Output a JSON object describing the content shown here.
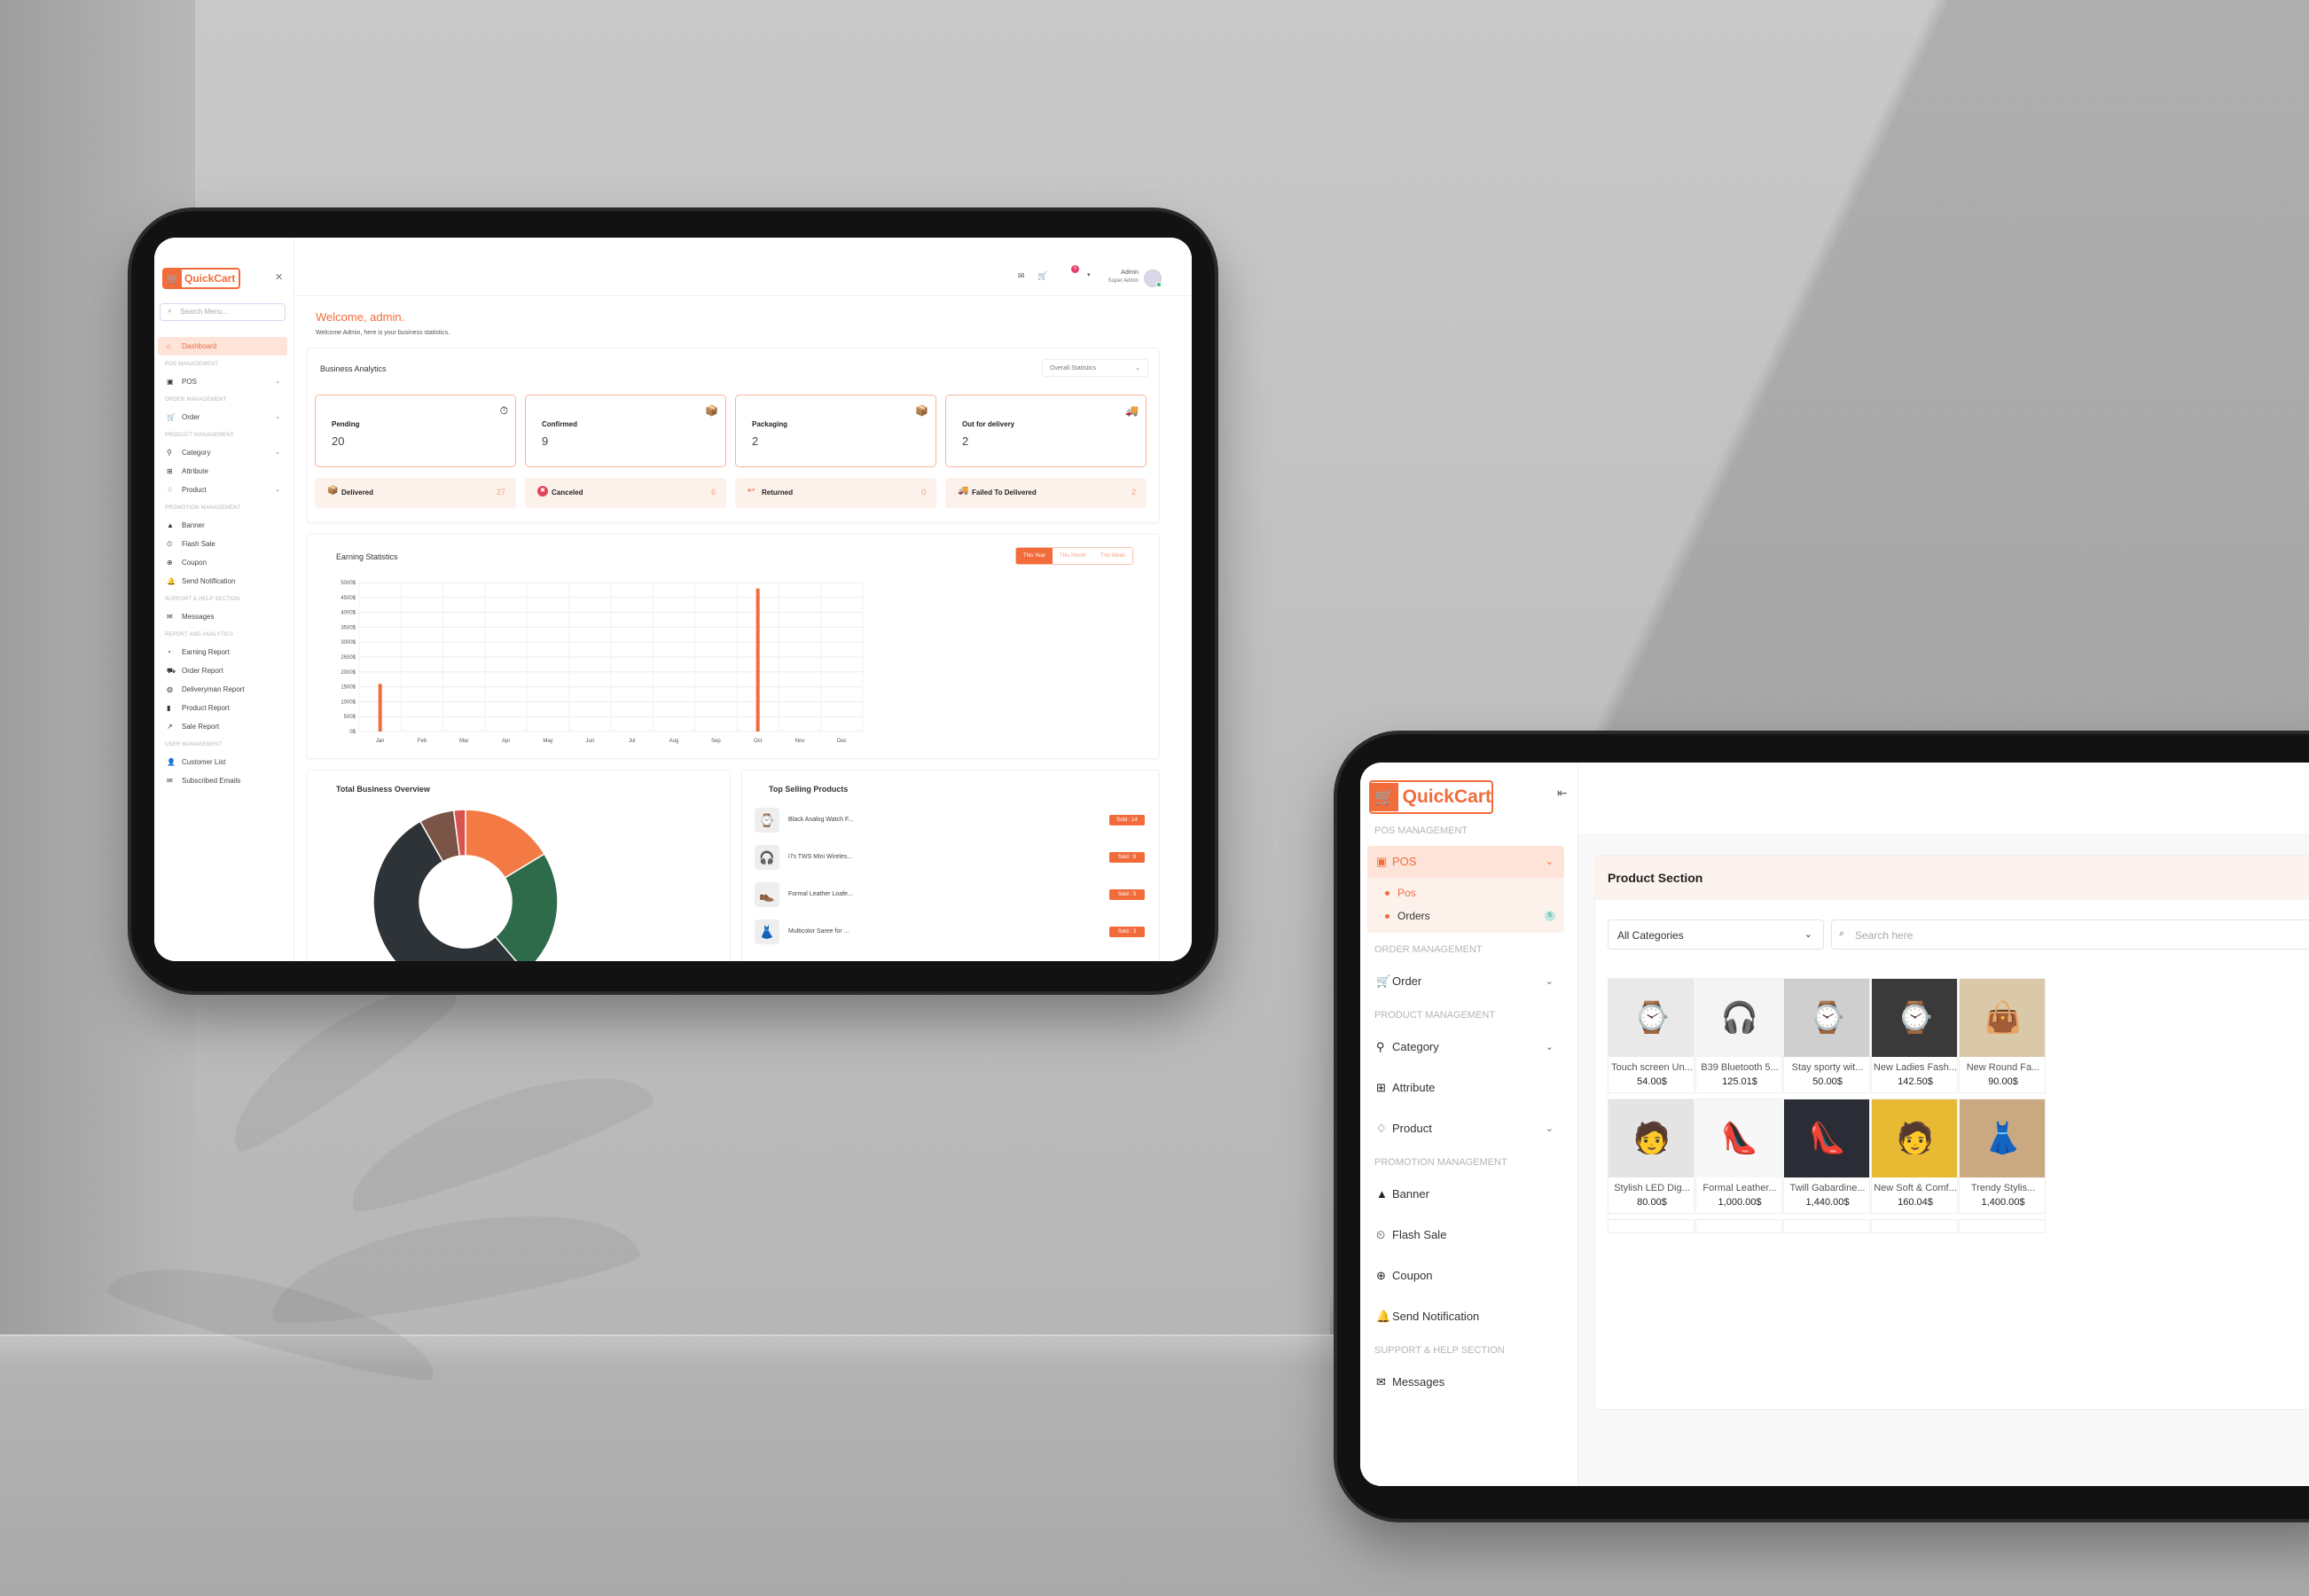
{
  "colors": {
    "accent": "#f26c3b",
    "accent_light": "#fde3d8",
    "accent_bg": "#fdf1ec"
  },
  "dashboard": {
    "brand": "QuickCart",
    "search_placeholder": "Search Menu...",
    "nav": [
      {
        "type": "item",
        "label": "Dashboard",
        "icon": "home-icon",
        "active": true
      },
      {
        "type": "section",
        "label": "POS MANAGEMENT"
      },
      {
        "type": "item",
        "label": "POS",
        "icon": "bag-icon",
        "chevron": true
      },
      {
        "type": "section",
        "label": "ORDER MANAGEMENT"
      },
      {
        "type": "item",
        "label": "Order",
        "icon": "cart-icon",
        "chevron": true
      },
      {
        "type": "section",
        "label": "PRODUCT MANAGEMENT"
      },
      {
        "type": "item",
        "label": "Category",
        "icon": "category-icon",
        "chevron": true
      },
      {
        "type": "item",
        "label": "Attribute",
        "icon": "grid-icon"
      },
      {
        "type": "item",
        "label": "Product",
        "icon": "tag-icon",
        "chevron": true
      },
      {
        "type": "section",
        "label": "PROMOTION MANAGEMENT"
      },
      {
        "type": "item",
        "label": "Banner",
        "icon": "image-icon"
      },
      {
        "type": "item",
        "label": "Flash Sale",
        "icon": "clock-icon"
      },
      {
        "type": "item",
        "label": "Coupon",
        "icon": "gift-icon"
      },
      {
        "type": "item",
        "label": "Send Notification",
        "icon": "bell-icon"
      },
      {
        "type": "section",
        "label": "SUPPORT & HELP SECTION"
      },
      {
        "type": "item",
        "label": "Messages",
        "icon": "mail-icon"
      },
      {
        "type": "section",
        "label": "REPORT AND ANALYTICS"
      },
      {
        "type": "item",
        "label": "Earning Report",
        "icon": "pie-icon"
      },
      {
        "type": "item",
        "label": "Order Report",
        "icon": "truck-icon"
      },
      {
        "type": "item",
        "label": "Deliveryman Report",
        "icon": "globe-icon"
      },
      {
        "type": "item",
        "label": "Product Report",
        "icon": "bar-chart-icon"
      },
      {
        "type": "item",
        "label": "Sale Report",
        "icon": "trend-icon"
      },
      {
        "type": "section",
        "label": "USER MANAGEMENT"
      },
      {
        "type": "item",
        "label": "Customer List",
        "icon": "user-icon"
      },
      {
        "type": "item",
        "label": "Subscribed Emails",
        "icon": "mail-icon"
      }
    ],
    "header": {
      "cart_count": "0",
      "admin_name": "Admin",
      "admin_role": "Super Admin"
    },
    "welcome": "Welcome, admin.",
    "welcome_sub": "Welcome Admin, here is your business statistics.",
    "analytics": {
      "title": "Business Analytics",
      "filter": "Overall Statistics",
      "cards": [
        {
          "label": "Pending",
          "value": "20",
          "icon": "pending-icon",
          "glyph": "⏱"
        },
        {
          "label": "Confirmed",
          "value": "9",
          "icon": "confirmed-icon",
          "glyph": "📦"
        },
        {
          "label": "Packaging",
          "value": "2",
          "icon": "packaging-icon",
          "glyph": "📦"
        },
        {
          "label": "Out for delivery",
          "value": "2",
          "icon": "delivery-truck-icon",
          "glyph": "🚚"
        }
      ],
      "mini": [
        {
          "label": "Delivered",
          "value": "27",
          "icon": "delivered-icon",
          "glyph": "📦"
        },
        {
          "label": "Canceled",
          "value": "6",
          "icon": "canceled-icon",
          "glyph": "✖"
        },
        {
          "label": "Returned",
          "value": "0",
          "icon": "returned-icon",
          "glyph": "↩"
        },
        {
          "label": "Failed To Delivered",
          "value": "2",
          "icon": "failed-icon",
          "glyph": "🚚"
        }
      ]
    },
    "earning": {
      "title": "Earning Statistics",
      "tabs": [
        "This Year",
        "This Month",
        "This Week"
      ]
    },
    "overview": {
      "title": "Total Business Overview"
    },
    "top_selling": {
      "title": "Top Selling Products",
      "items": [
        {
          "name": "Black Analog Watch F...",
          "sold": "Sold : 14",
          "glyph": "⌚"
        },
        {
          "name": "i7s TWS Mini Wireles...",
          "sold": "Sold : 8",
          "glyph": "🎧"
        },
        {
          "name": "Formal Leather Loafe...",
          "sold": "Sold : 5",
          "glyph": "👞"
        },
        {
          "name": "Multicolor Saree for ...",
          "sold": "Sold : 3",
          "glyph": "👗"
        }
      ]
    }
  },
  "chart_data": [
    {
      "type": "bar",
      "title": "Earning Statistics",
      "categories": [
        "Jan",
        "Feb",
        "Mar",
        "Apr",
        "May",
        "Jun",
        "Jul",
        "Aug",
        "Sep",
        "Oct",
        "Nov",
        "Dec"
      ],
      "values": [
        1600,
        0,
        0,
        0,
        0,
        0,
        0,
        0,
        0,
        4800,
        0,
        0
      ],
      "ylim": [
        0,
        5000
      ],
      "yticks": [
        "0$",
        "500$",
        "1000$",
        "1500$",
        "2000$",
        "2500$",
        "3000$",
        "3500$",
        "4000$",
        "4500$",
        "5000$"
      ],
      "grid": true,
      "color": "#f26c3b"
    },
    {
      "type": "pie",
      "title": "Total Business Overview",
      "variant": "donut",
      "values": [
        16,
        22,
        52,
        6,
        2
      ],
      "colors": [
        "#f47a45",
        "#2e6b4a",
        "#2e3338",
        "#7a5446",
        "#d9534f"
      ]
    }
  ],
  "pos": {
    "brand": "QuickCart",
    "nav": [
      {
        "type": "section",
        "label": "POS MANAGEMENT"
      },
      {
        "type": "item",
        "label": "POS",
        "icon": "bag-icon",
        "chevron": true,
        "active": true,
        "sub": [
          {
            "label": "Pos",
            "on": true
          },
          {
            "label": "Orders",
            "count": "5"
          }
        ]
      },
      {
        "type": "section",
        "label": "ORDER MANAGEMENT"
      },
      {
        "type": "item",
        "label": "Order",
        "icon": "cart-icon",
        "chevron": true
      },
      {
        "type": "section",
        "label": "PRODUCT MANAGEMENT"
      },
      {
        "type": "item",
        "label": "Category",
        "icon": "category-icon",
        "chevron": true
      },
      {
        "type": "item",
        "label": "Attribute",
        "icon": "grid-icon"
      },
      {
        "type": "item",
        "label": "Product",
        "icon": "tag-icon",
        "chevron": true
      },
      {
        "type": "section",
        "label": "PROMOTION MANAGEMENT"
      },
      {
        "type": "item",
        "label": "Banner",
        "icon": "image-icon"
      },
      {
        "type": "item",
        "label": "Flash Sale",
        "icon": "clock-icon"
      },
      {
        "type": "item",
        "label": "Coupon",
        "icon": "gift-icon"
      },
      {
        "type": "item",
        "label": "Send Notification",
        "icon": "bell-icon"
      },
      {
        "type": "section",
        "label": "SUPPORT & HELP SECTION"
      },
      {
        "type": "item",
        "label": "Messages",
        "icon": "mail-icon"
      }
    ],
    "section_title": "Product Section",
    "category_select": "All Categories",
    "search_placeholder": "Search here",
    "products": [
      {
        "name": "Touch screen Un...",
        "price": "54.00$",
        "bg": "#e9e9e9",
        "glyph": "⌚"
      },
      {
        "name": "B39 Bluetooth 5...",
        "price": "125.01$",
        "bg": "#f4f4f4",
        "glyph": "🎧"
      },
      {
        "name": "Stay sporty wit...",
        "price": "50.00$",
        "bg": "#cfcfcf",
        "glyph": "⌚"
      },
      {
        "name": "New Ladies Fash...",
        "price": "142.50$",
        "bg": "#3a3a3a",
        "glyph": "⌚"
      },
      {
        "name": "New Round Fa...",
        "price": "90.00$",
        "bg": "#d9c9a8",
        "glyph": "👜"
      },
      {
        "name": "Stylish LED Dig...",
        "price": "80.00$",
        "bg": "#e4e4e4",
        "glyph": "🧑"
      },
      {
        "name": "Formal Leather...",
        "price": "1,000.00$",
        "bg": "#f7f7f7",
        "glyph": "👠"
      },
      {
        "name": "Twill Gabardine...",
        "price": "1,440.00$",
        "bg": "#2a2d35",
        "glyph": "👠"
      },
      {
        "name": "New Soft & Comf...",
        "price": "160.04$",
        "bg": "#e8b932",
        "glyph": "🧑"
      },
      {
        "name": "Trendy Stylis...",
        "price": "1,400.00$",
        "bg": "#c9a882",
        "glyph": "👗"
      }
    ]
  }
}
